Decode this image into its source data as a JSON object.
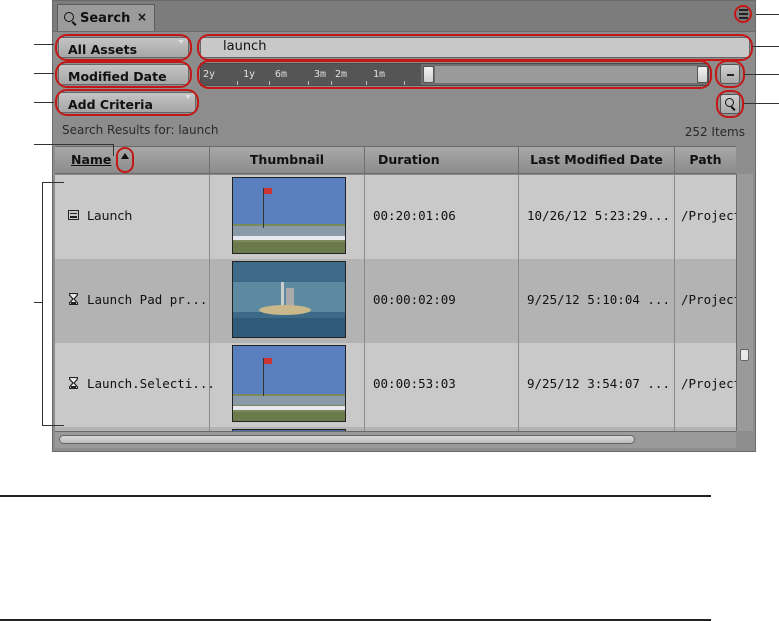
{
  "tab": {
    "title": "Search",
    "close": "×"
  },
  "filters": {
    "scope": "All Assets",
    "query": "launch",
    "date_filter": "Modified Date",
    "add_criteria": "Add Criteria"
  },
  "timeline": {
    "ticks": [
      "2y",
      "1y",
      "6m",
      "3m",
      "2m",
      "1m"
    ]
  },
  "results": {
    "label": "Search Results for: launch",
    "count": "252 Items"
  },
  "table": {
    "columns": [
      "Name",
      "Thumbnail",
      "Duration",
      "Last Modified Date",
      "Path"
    ],
    "rows": [
      {
        "name": "Launch",
        "duration": "00:20:01:06",
        "modified": "10/26/12 5:23:29...",
        "path": "/Project"
      },
      {
        "name": "Launch Pad pr...",
        "duration": "00:00:02:09",
        "modified": "9/25/12 5:10:04 ...",
        "path": "/Project"
      },
      {
        "name": "Launch.Selecti...",
        "duration": "00:00:53:03",
        "modified": "9/25/12 3:54:07 ...",
        "path": "/Project"
      }
    ]
  },
  "icons": {
    "tab": "search-icon",
    "menu": "hamburger-menu-icon",
    "collapse": "minus-icon",
    "run": "magnifier-icon",
    "sort": "sort-ascending-icon",
    "row0": "sequence-icon",
    "row1": "hourglass-icon",
    "row2": "hourglass-icon"
  },
  "colors": {
    "callout_ring": "#c41818",
    "panel_bg": "#8d8d8d",
    "row_odd": "#c9c9c9",
    "row_even": "#b3b3b3"
  }
}
